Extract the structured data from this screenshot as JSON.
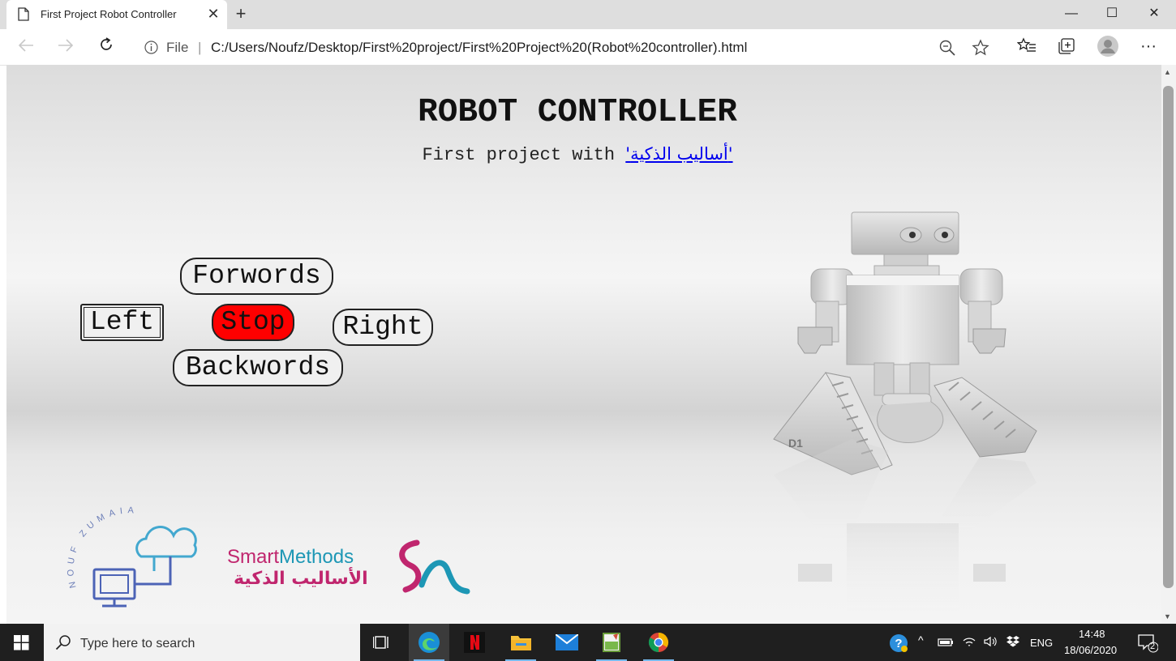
{
  "browser": {
    "tab_title": "First Project Robot Controller",
    "tab_close": "✕",
    "new_tab": "+",
    "url_scheme_label": "File",
    "url_separator": "|",
    "url": "C:/Users/Noufz/Desktop/First%20project/First%20Project%20(Robot%20controller).html",
    "window_controls": {
      "minimize": "—",
      "maximize": "☐",
      "close": "✕"
    },
    "more_menu": "···"
  },
  "page": {
    "title": "ROBOT CONTROLLER",
    "subtitle_prefix": "First project with ",
    "subtitle_link": "'أساليب الذكية'",
    "controls": {
      "forward": "Forwords",
      "left": "Left",
      "stop": "Stop",
      "right": "Right",
      "backward": "Backwords"
    },
    "stop_color": "#ff0000",
    "robot_marking": "D1",
    "logo_nouf_text": "NOUF ZUMAIA",
    "logo_smart_methods": {
      "part1": "Smart",
      "part2": "Methods",
      "arabic": "الأساليب الذكية"
    }
  },
  "taskbar": {
    "search_placeholder": "Type here to search",
    "language": "ENG",
    "time": "14:48",
    "date": "18/06/2020",
    "notification_count": "2",
    "apps": [
      "task-view-icon",
      "edge-icon",
      "netflix-icon",
      "file-explorer-icon",
      "mail-icon",
      "notepad-icon",
      "chrome-icon"
    ]
  }
}
